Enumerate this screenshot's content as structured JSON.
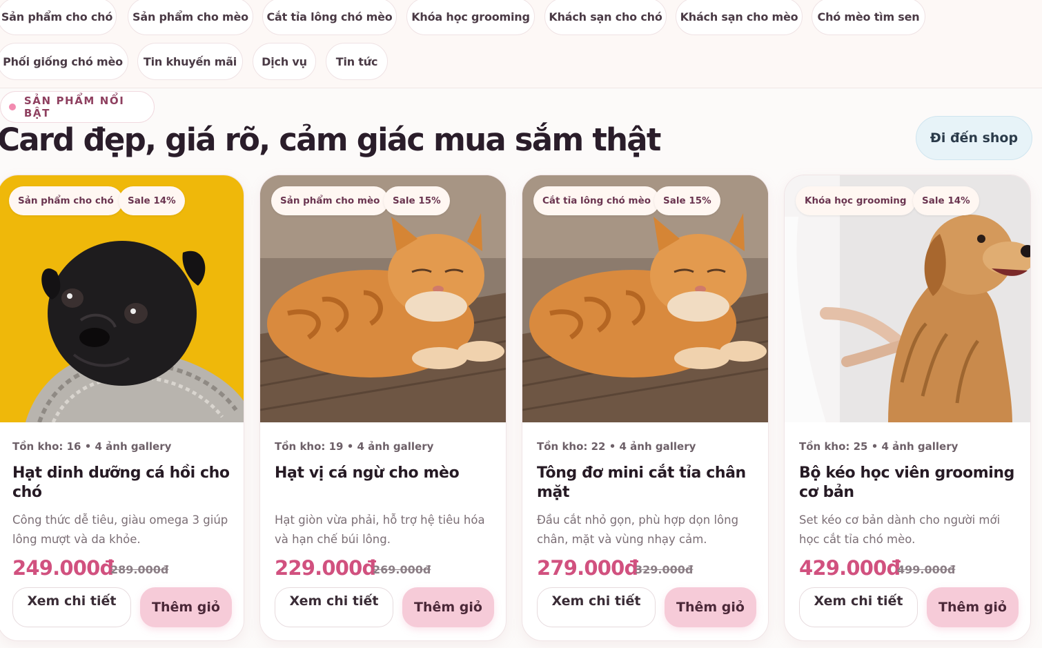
{
  "nav": {
    "items": [
      "Sản phẩm cho chó",
      "Sản phẩm cho mèo",
      "Cắt tỉa lông chó mèo",
      "Khóa học grooming",
      "Khách sạn cho chó",
      "Khách sạn cho mèo",
      "Chó mèo tìm sen",
      "Phối giống chó mèo",
      "Tin khuyến mãi",
      "Dịch vụ",
      "Tin tức"
    ]
  },
  "section": {
    "badge": "SẢN PHẨM NỔI BẬT",
    "headline": "Card đẹp, giá rõ, cảm giác mua sắm thật",
    "shop_button": "Đi đến shop"
  },
  "products": [
    {
      "category": "Sản phẩm cho chó",
      "sale": "Sale 14%",
      "meta": "Tồn kho: 16 • 4 ảnh gallery",
      "title": "Hạt dinh dưỡng cá hồi cho chó",
      "desc": "Công thức dễ tiêu, giàu omega 3 giúp lông mượt và da khỏe.",
      "price": "249.000đ",
      "old_price": "289.000đ",
      "detail_label": "Xem chi tiết",
      "cart_label": "Thêm giỏ",
      "image": "pug-dog-photo"
    },
    {
      "category": "Sản phẩm cho mèo",
      "sale": "Sale 15%",
      "meta": "Tồn kho: 19 • 4 ảnh gallery",
      "title": "Hạt vị cá ngừ cho mèo",
      "desc": "Hạt giòn vừa phải, hỗ trợ hệ tiêu hóa và hạn chế búi lông.",
      "price": "229.000đ",
      "old_price": "269.000đ",
      "detail_label": "Xem chi tiết",
      "cart_label": "Thêm giỏ",
      "image": "orange-cat-photo"
    },
    {
      "category": "Cắt tỉa lông chó mèo",
      "sale": "Sale 15%",
      "meta": "Tồn kho: 22 • 4 ảnh gallery",
      "title": "Tông đơ mini cắt tỉa chân mặt",
      "desc": "Đầu cắt nhỏ gọn, phù hợp dọn lông chân, mặt và vùng nhạy cảm.",
      "price": "279.000đ",
      "old_price": "329.000đ",
      "detail_label": "Xem chi tiết",
      "cart_label": "Thêm giỏ",
      "image": "orange-cat-photo"
    },
    {
      "category": "Khóa học grooming",
      "sale": "Sale 14%",
      "meta": "Tồn kho: 25 • 4 ảnh gallery",
      "title": "Bộ kéo học viên grooming cơ bản",
      "desc": "Set kéo cơ bản dành cho người mới học cắt tỉa chó mèo.",
      "price": "429.000đ",
      "old_price": "499.000đ",
      "detail_label": "Xem chi tiết",
      "cart_label": "Thêm giỏ",
      "image": "golden-retriever-grooming-photo"
    }
  ],
  "colors": {
    "accent_pink": "#d1517f",
    "cart_button": "#f6cbd8",
    "shop_button": "#e7f3f8",
    "pug_background": "#efb80a"
  }
}
